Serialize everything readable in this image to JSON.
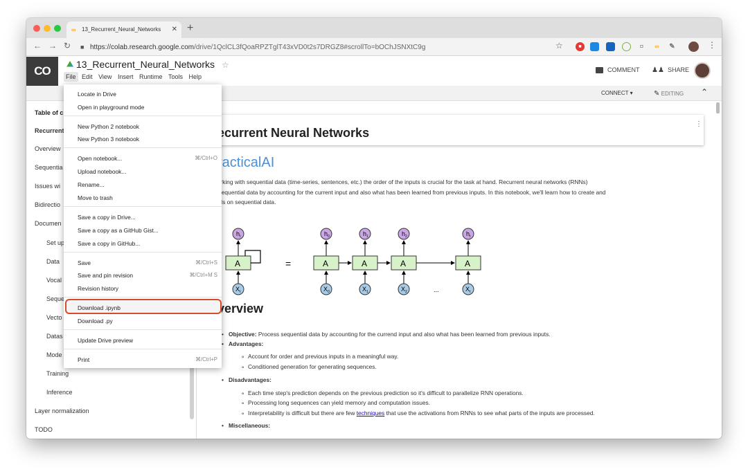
{
  "browser": {
    "tab_title": "13_Recurrent_Neural_Networks",
    "tab_close": "✕",
    "url_host": "https://colab.research.google.com",
    "url_path": "/drive/1QclCL3fQoaRPZTglT43xVD0t2s7DRGZ8#scrollTo=bOChJSNXtC9g"
  },
  "header": {
    "logo": "CO",
    "notebook_title": "13_Recurrent_Neural_Networks",
    "menus": [
      "File",
      "Edit",
      "View",
      "Insert",
      "Runtime",
      "Tools",
      "Help"
    ],
    "comment_label": "COMMENT",
    "share_label": "SHARE"
  },
  "subbar": {
    "connect_label": "CONNECT",
    "editing_label": "EDITING"
  },
  "sidebar": {
    "title": "Table of c",
    "items": [
      "Recurrent",
      "Overview",
      "Sequentia",
      "Issues wi",
      "Bidirectio",
      "Documen",
      "Set up",
      "Data",
      "Vocal",
      "Seque",
      "Vecto",
      "Datas",
      "Mode",
      "Training",
      "Inference",
      "Layer normalization",
      "TODO"
    ]
  },
  "file_menu": {
    "groups": [
      [
        {
          "label": "Locate in Drive"
        },
        {
          "label": "Open in playground mode"
        }
      ],
      [
        {
          "label": "New Python 2 notebook"
        },
        {
          "label": "New Python 3 notebook"
        }
      ],
      [
        {
          "label": "Open notebook...",
          "shortcut": "⌘/Ctrl+O"
        },
        {
          "label": "Upload notebook..."
        },
        {
          "label": "Rename..."
        },
        {
          "label": "Move to trash"
        }
      ],
      [
        {
          "label": "Save a copy in Drive..."
        },
        {
          "label": "Save a copy as a GitHub Gist..."
        },
        {
          "label": "Save a copy in GitHub..."
        }
      ],
      [
        {
          "label": "Save",
          "shortcut": "⌘/Ctrl+S"
        },
        {
          "label": "Save and pin revision",
          "shortcut": "⌘/Ctrl+M S"
        },
        {
          "label": "Revision history"
        }
      ],
      [
        {
          "label": "Download .ipynb"
        },
        {
          "label": "Download .py"
        }
      ],
      [
        {
          "label": "Update Drive preview"
        }
      ],
      [
        {
          "label": "Print",
          "shortcut": "⌘/Ctrl+P"
        }
      ]
    ],
    "highlighted": "Download .ipynb"
  },
  "main": {
    "heading": "ecurrent Neural Networks",
    "brand": "racticalAI",
    "intro_lines": [
      "en working with sequential data (time-series, sentences, etc.) the order of the inputs is crucial for the task at hand. Recurrent neural networks (RNNs)",
      "cess sequential data by accounting for the current input and also what has been learned from previous inputs. In this notebook, we'll learn how to create and",
      "n RNNs on sequential data."
    ],
    "overview_heading": "verview",
    "objective_label": "Objective:",
    "objective_text": " Process sequential data by accounting for the currend input and also what has been learned from previous inputs.",
    "advantages_label": "Advantages:",
    "advantages": [
      "Account for order and previous inputs in a meaningful way.",
      "Conditioned generation for generating sequences."
    ],
    "disadvantages_label": "Disadvantages:",
    "disadvantages": [
      "Each time step's prediction depends on the previous prediction so it's difficult to parallelize RNN operations.",
      "Processing long sequences can yield memory and computation issues."
    ],
    "interp_before": "Interpretability is difficult but there are few ",
    "interp_link": "techniques",
    "interp_after": " that use the activations from RNNs to see what parts of the inputs are processed.",
    "misc_label": "Miscellaneous:"
  },
  "diagram": {
    "cell_label": "A",
    "equals": "=",
    "ellipsis": "...",
    "hidden_labels": [
      "h",
      "h",
      "h",
      "h",
      "h"
    ],
    "input_labels": [
      "X",
      "X",
      "X",
      "X",
      "X"
    ],
    "hidden_subs": [
      "t",
      "0",
      "1",
      "2",
      "t"
    ],
    "input_subs": [
      "t",
      "0",
      "1",
      "2",
      "t"
    ]
  }
}
